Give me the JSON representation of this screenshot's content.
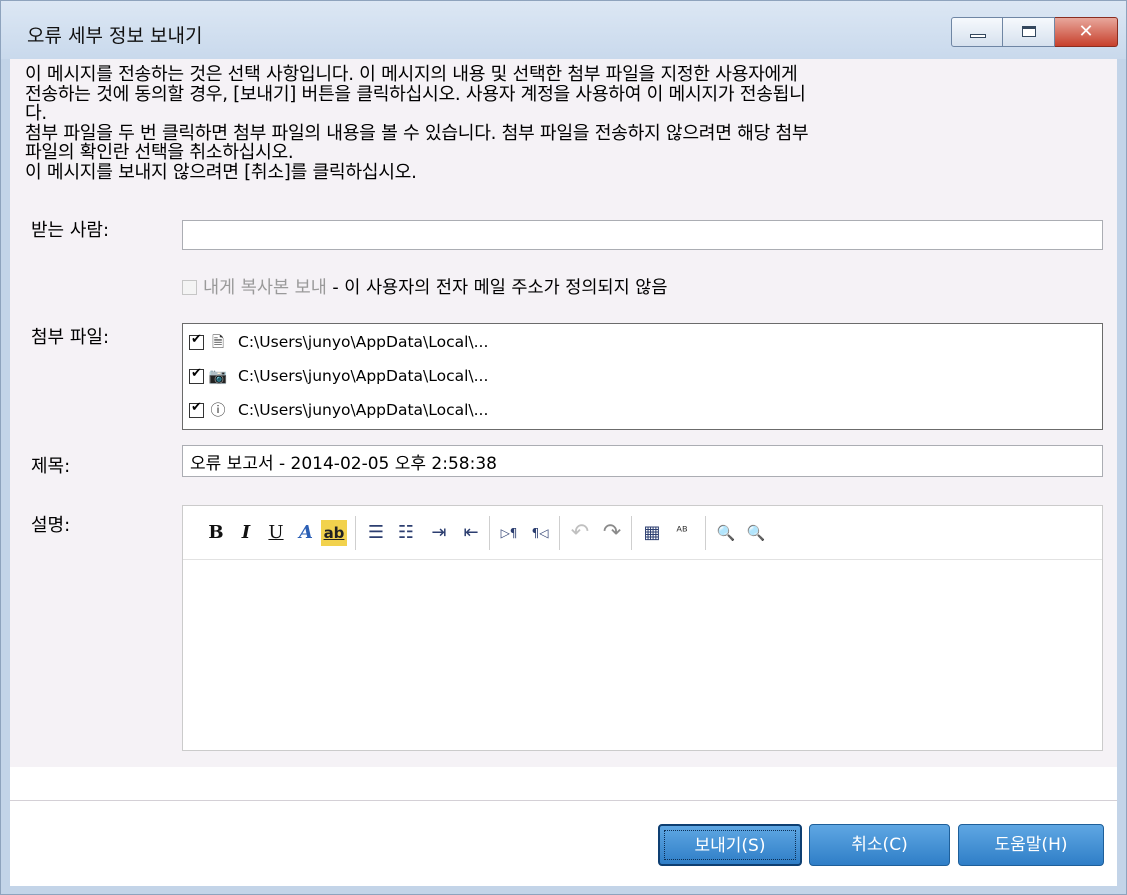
{
  "window": {
    "title": "오류 세부 정보 보내기",
    "controls": {
      "minimize": "▭",
      "maximize": "□",
      "close": "✕"
    }
  },
  "intro": {
    "lines": [
      "이 메시지를 전송하는 것은 선택 사항입니다. 이 메시지의 내용 및 선택한 첨부 파일을 지정한 사용자에게",
      "전송하는 것에 동의할 경우, [보내기] 버튼을 클릭하십시오. 사용자 계정을 사용하여 이 메시지가 전송됩니",
      "다.",
      "첨부 파일을 두 번 클릭하면 첨부 파일의 내용을 볼 수 있습니다. 첨부 파일을 전송하지 않으려면 해당 첨부",
      "파일의 확인란 선택을 취소하십시오.",
      "이 메시지를 보내지 않으려면 [취소]를 클릭하십시오."
    ]
  },
  "form": {
    "to_label": "받는 사람:",
    "to_value": "",
    "cc_label": "내게 복사본 보내",
    "cc_note": "- 이 사용자의 전자 메일 주소가 정의되지 않음",
    "attach_label": "첨부 파일:",
    "attachments": [
      {
        "icon": "document-icon",
        "path": "C:\\Users\\junyo\\AppData\\Local\\...",
        "checked": true
      },
      {
        "icon": "camera-icon",
        "path": "C:\\Users\\junyo\\AppData\\Local\\...",
        "checked": true
      },
      {
        "icon": "info-icon",
        "path": "C:\\Users\\junyo\\AppData\\Local\\...",
        "checked": true
      }
    ],
    "subject_label": "제목:",
    "subject_value": "오류 보고서 - 2014-02-05 오후 2:58:38",
    "desc_label": "설명:",
    "desc_value": ""
  },
  "toolbar": {
    "bold": "B",
    "italic": "I",
    "underline": "U",
    "font_color": "A",
    "highlight": "ab",
    "bullets": "☰",
    "numbering": "☷",
    "indent": "⇥",
    "outdent": "⇤",
    "ltr": "▷¶",
    "rtl": "¶◁",
    "undo": "↶",
    "redo": "↷",
    "table": "▦",
    "spell": "ᴬᴮ",
    "zoom_out": "🔍",
    "zoom_in": "🔍"
  },
  "buttons": {
    "send": "보내기(S)",
    "cancel": "취소(C)",
    "help": "도움말(H)"
  },
  "colors": {
    "accent": "#3b8ad2",
    "titlebar": "#c9d9ec",
    "close": "#c7402c"
  }
}
